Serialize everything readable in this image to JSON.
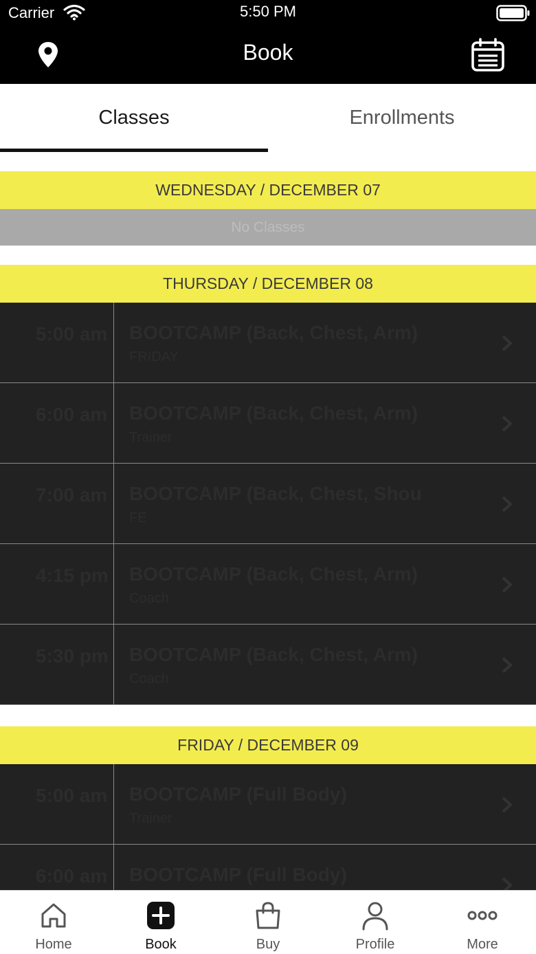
{
  "status_bar": {
    "carrier": "Carrier",
    "time": "5:50 PM"
  },
  "header": {
    "title": "Book",
    "left_icon": "location-pin-icon",
    "right_icon": "calendar-list-icon"
  },
  "tabs": [
    {
      "label": "Classes",
      "active": true
    },
    {
      "label": "Enrollments",
      "active": false
    }
  ],
  "colors": {
    "accent": "#f3ec4f",
    "header_bg": "#000000",
    "row_bg": "#222222",
    "empty_bg": "#a9a9a9"
  },
  "days": [
    {
      "header": "WEDNESDAY / DECEMBER 07",
      "empty_text": "No Classes",
      "classes": []
    },
    {
      "header": "THURSDAY / DECEMBER 08",
      "classes": [
        {
          "time": "5:00 am",
          "name": "BOOTCAMP (Back, Chest, Arm)",
          "sub": "FRIDAY"
        },
        {
          "time": "6:00 am",
          "name": "BOOTCAMP (Back, Chest, Arm)",
          "sub": "Trainer"
        },
        {
          "time": "7:00 am",
          "name": "BOOTCAMP (Back, Chest, Shou",
          "sub": "FE"
        },
        {
          "time": "4:15 pm",
          "name": "BOOTCAMP (Back, Chest, Arm)",
          "sub": "Coach"
        },
        {
          "time": "5:30 pm",
          "name": "BOOTCAMP (Back, Chest, Arm)",
          "sub": "Coach"
        }
      ]
    },
    {
      "header": "FRIDAY / DECEMBER 09",
      "classes": [
        {
          "time": "5:00 am",
          "name": "BOOTCAMP (Full Body)",
          "sub": "Trainer"
        },
        {
          "time": "6:00 am",
          "name": "BOOTCAMP (Full Body)",
          "sub": ""
        }
      ]
    }
  ],
  "bottom_nav": [
    {
      "label": "Home",
      "icon": "home-icon",
      "active": false
    },
    {
      "label": "Book",
      "icon": "plus-square-icon",
      "active": true
    },
    {
      "label": "Buy",
      "icon": "shopping-bag-icon",
      "active": false
    },
    {
      "label": "Profile",
      "icon": "person-icon",
      "active": false
    },
    {
      "label": "More",
      "icon": "more-dots-icon",
      "active": false
    }
  ]
}
